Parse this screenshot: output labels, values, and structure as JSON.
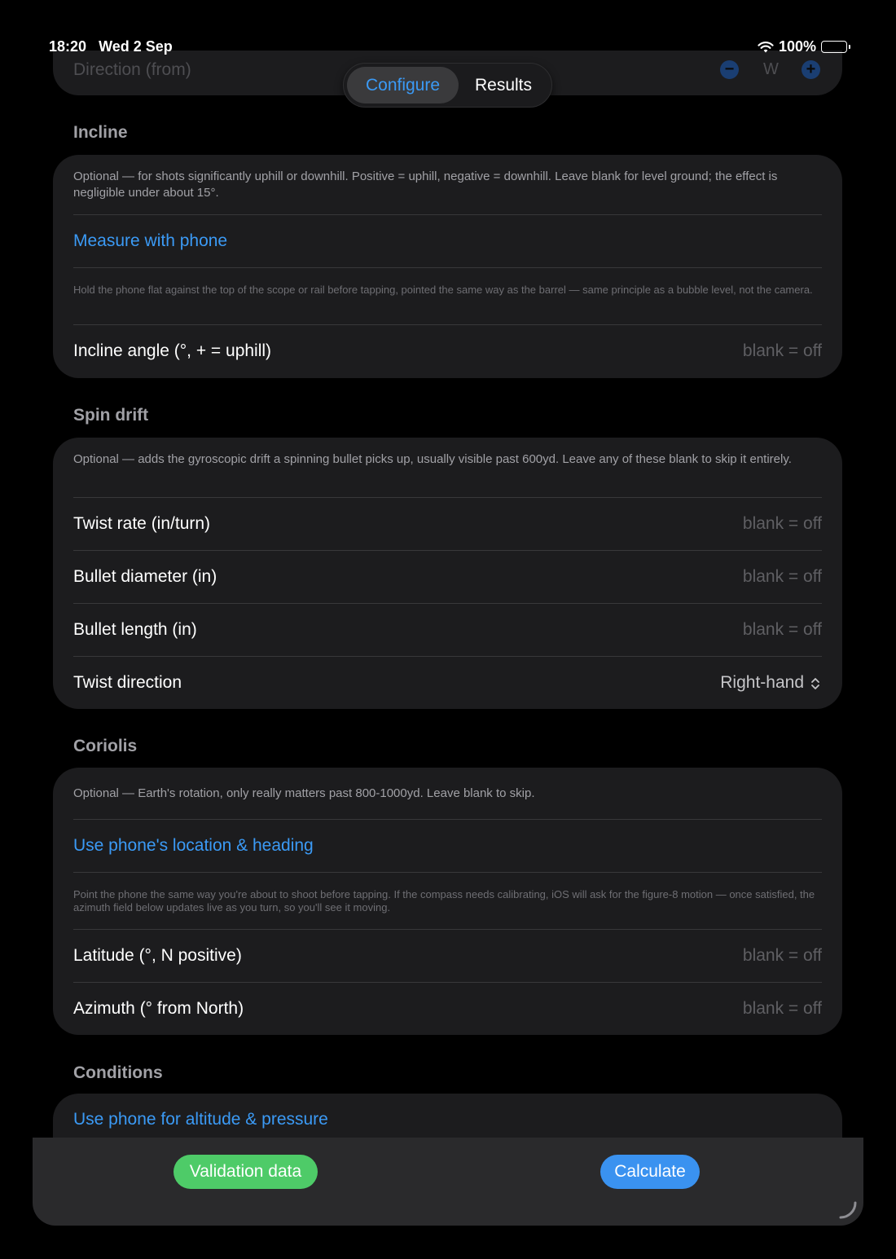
{
  "status_bar": {
    "time": "18:20",
    "date": "Wed 2 Sep",
    "battery": "100%"
  },
  "direction": {
    "label": "Direction (from)",
    "value": "W",
    "minus_icon": "minus-circle-icon",
    "plus_icon": "plus-circle-icon"
  },
  "tabs": {
    "configure": "Configure",
    "results": "Results",
    "selected": "Configure"
  },
  "incline": {
    "header": "Incline",
    "description": "Optional — for shots significantly uphill or downhill. Positive = uphill, negative = downhill. Leave blank for level ground; the effect is negligible under about 15°.",
    "measure_link": "Measure with phone",
    "hint": "Hold the phone flat against the top of the scope or rail before tapping, pointed the same way as the barrel — same principle as a bubble level, not the camera.",
    "angle_label": "Incline angle (°, + = uphill)",
    "angle_placeholder": "blank = off"
  },
  "spin_drift": {
    "header": "Spin drift",
    "description": "Optional — adds the gyroscopic drift a spinning bullet picks up, usually visible past 600yd. Leave any of these blank to skip it entirely.",
    "twist_rate_label": "Twist rate (in/turn)",
    "twist_rate_placeholder": "blank = off",
    "diameter_label": "Bullet diameter (in)",
    "diameter_placeholder": "blank = off",
    "length_label": "Bullet length (in)",
    "length_placeholder": "blank = off",
    "twist_direction_label": "Twist direction",
    "twist_direction_value": "Right-hand"
  },
  "coriolis": {
    "header": "Coriolis",
    "description": "Optional — Earth's rotation, only really matters past 800-1000yd. Leave blank to skip.",
    "location_link": "Use phone's location & heading",
    "hint": "Point the phone the same way you're about to shoot before tapping. If the compass needs calibrating, iOS will ask for the figure-8 motion — once satisfied, the azimuth field below updates live as you turn, so you'll see it moving.",
    "latitude_label": "Latitude (°, N positive)",
    "latitude_placeholder": "blank = off",
    "azimuth_label": "Azimuth (° from North)",
    "azimuth_placeholder": "blank = off"
  },
  "conditions": {
    "header": "Conditions",
    "altitude_link": "Use phone for altitude & pressure"
  },
  "actions": {
    "validation": "Validation data",
    "calculate": "Calculate"
  },
  "colors": {
    "accent_blue": "#3b9af5",
    "validation_green": "#4ecb68",
    "calculate_blue": "#3a92f0",
    "card_bg": "#1c1c1e"
  }
}
